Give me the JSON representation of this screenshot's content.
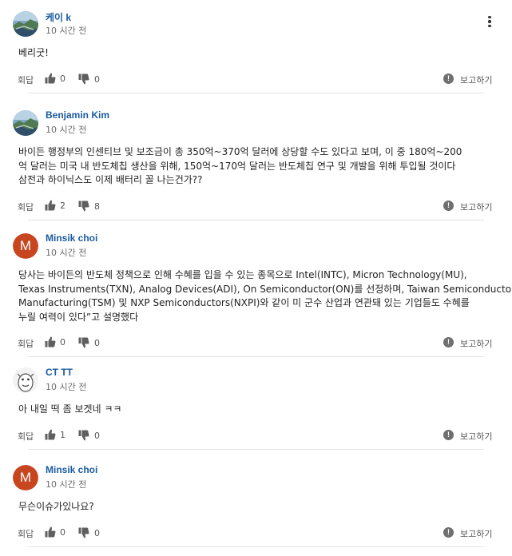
{
  "colors": {
    "author": "#1a5ba0",
    "avatar_m": "#c8461f",
    "meta_text": "#6b6b6b",
    "divider": "#e3e3e3"
  },
  "labels": {
    "reply": "회답",
    "report": "보고하기",
    "report_icon": "!"
  },
  "comments": [
    {
      "author": "케이 k",
      "time": "10 시간 전",
      "avatar": "landscape-photo",
      "lines": [
        "베리굿!"
      ],
      "likes": "0",
      "dislikes": "0"
    },
    {
      "author": "Benjamin Kim",
      "time": "10 시간 전",
      "avatar": "landscape-photo",
      "lines": [
        "바이든 행정부의 인센티브 및 보조금이 총 350억~370억 달러에 상당할 수도 있다고 보며, 이 중 180억~200",
        "억 달러는 미국 내 반도체칩 생산을 위해, 150억~170억 달러는 반도체칩 연구 및 개발을 위해 투입될 것이다",
        "삼전과 하이닉스도 이제 배터리 꼴 나는건가??"
      ],
      "likes": "2",
      "dislikes": "8"
    },
    {
      "author": "Minsik choi",
      "time": "10 시간 전",
      "avatar": "letter",
      "avatar_letter": "M",
      "lines": [
        "당사는 바이든의 반도체 정책으로 인해 수혜를 입을 수 있는 종목으로 Intel(INTC), Micron Technology(MU),",
        "Texas Instruments(TXN), Analog Devices(ADI), On Semiconductor(ON)를 선정하며, Taiwan Semiconductor",
        "Manufacturing(TSM) 및 NXP Semiconductors(NXPI)와 같이 미 군수 산업과 연관돼 있는 기업들도 수혜를",
        "누릴 여력이 있다”고 설명했다"
      ],
      "likes": "0",
      "dislikes": "0"
    },
    {
      "author": "CT TT",
      "time": "10 시간 전",
      "avatar": "cartoon",
      "lines": [
        "아 내일 떡 좀 보겟네 ㅋㅋ"
      ],
      "likes": "1",
      "dislikes": "0"
    },
    {
      "author": "Minsik choi",
      "time": "10 시간 전",
      "avatar": "letter",
      "avatar_letter": "M",
      "lines": [
        "무슨이슈가있나요?"
      ],
      "likes": "0",
      "dislikes": "0"
    }
  ]
}
